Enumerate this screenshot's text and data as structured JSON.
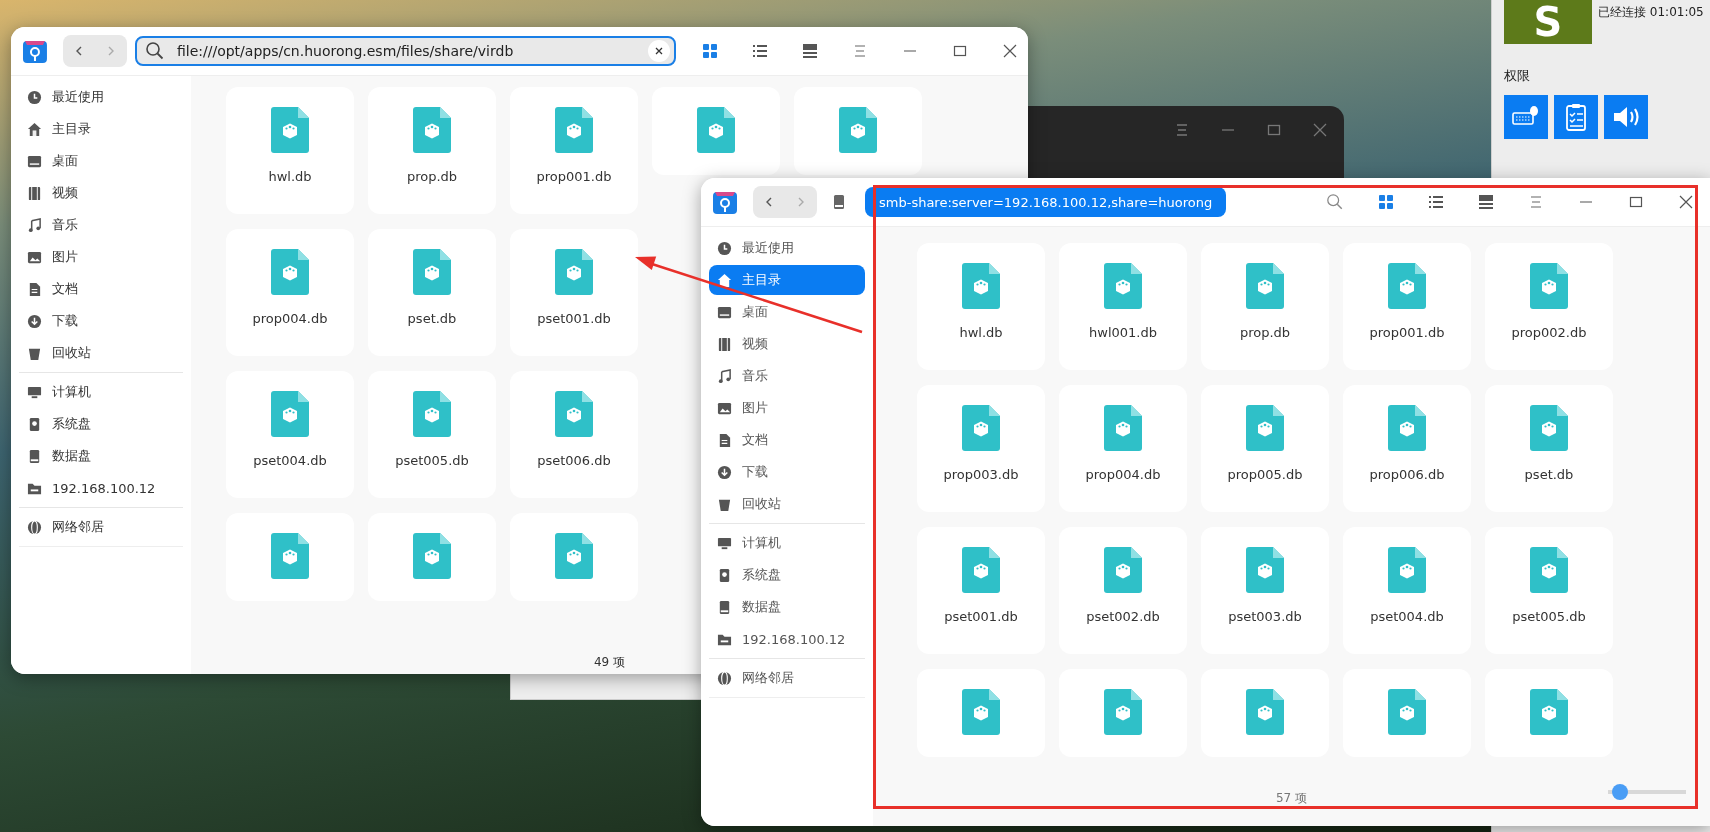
{
  "status_panel": {
    "avatar_letter": "S",
    "connection": "已经连接 01:01:05",
    "section_title": "权限"
  },
  "windows": [
    {
      "address": {
        "kind": "field",
        "value": "file:///opt/apps/cn.huorong.esm/files/share/virdb"
      },
      "views": [
        {
          "selected": true
        },
        {
          "selected": false
        },
        {
          "selected": false
        }
      ],
      "sidebar": [
        [
          {
            "label": "最近使用",
            "selected": false
          },
          {
            "label": "主目录",
            "selected": false
          },
          {
            "label": "桌面",
            "selected": false
          },
          {
            "label": "视频",
            "selected": false
          },
          {
            "label": "音乐",
            "selected": false
          },
          {
            "label": "图片",
            "selected": false
          },
          {
            "label": "文档",
            "selected": false
          },
          {
            "label": "下载",
            "selected": false
          },
          {
            "label": "回收站",
            "selected": false
          }
        ],
        [
          {
            "label": "计算机",
            "selected": false
          },
          {
            "label": "系统盘",
            "selected": false
          },
          {
            "label": "数据盘",
            "selected": false
          },
          {
            "label": "192.168.100.12",
            "selected": false
          }
        ],
        [
          {
            "label": "网络邻居",
            "selected": false
          }
        ]
      ],
      "rows": [
        [
          {
            "name": "hwl.db"
          },
          {
            "name": "prop.db"
          },
          {
            "name": "prop001.db"
          },
          {},
          {}
        ],
        [
          {
            "name": "prop004.db"
          },
          {
            "name": "pset.db"
          },
          {
            "name": "pset001.db"
          }
        ],
        [
          {
            "name": "pset004.db"
          },
          {
            "name": "pset005.db"
          },
          {
            "name": "pset006.db"
          }
        ],
        [
          {},
          {},
          {}
        ]
      ],
      "status": "49 项"
    },
    {
      "address": {
        "kind": "breadcrumb",
        "value": "smb-share:server=192.168.100.12,share=huorong"
      },
      "views": [
        {
          "selected": true
        },
        {
          "selected": false
        },
        {
          "selected": false
        }
      ],
      "sidebar": [
        [
          {
            "label": "最近使用",
            "selected": false
          },
          {
            "label": "主目录",
            "selected": true
          },
          {
            "label": "桌面",
            "selected": false
          },
          {
            "label": "视频",
            "selected": false
          },
          {
            "label": "音乐",
            "selected": false
          },
          {
            "label": "图片",
            "selected": false
          },
          {
            "label": "文档",
            "selected": false
          },
          {
            "label": "下载",
            "selected": false
          },
          {
            "label": "回收站",
            "selected": false
          }
        ],
        [
          {
            "label": "计算机",
            "selected": false
          },
          {
            "label": "系统盘",
            "selected": false
          },
          {
            "label": "数据盘",
            "selected": false
          },
          {
            "label": "192.168.100.12",
            "selected": false
          }
        ],
        [
          {
            "label": "网络邻居",
            "selected": false
          }
        ]
      ],
      "rows": [
        [
          {
            "name": "hwl.db"
          },
          {
            "name": "hwl001.db"
          },
          {
            "name": "prop.db"
          },
          {
            "name": "prop001.db"
          },
          {
            "name": "prop002.db"
          }
        ],
        [
          {
            "name": "prop003.db"
          },
          {
            "name": "prop004.db"
          },
          {
            "name": "prop005.db"
          },
          {
            "name": "prop006.db"
          },
          {
            "name": "pset.db"
          }
        ],
        [
          {
            "name": "pset001.db"
          },
          {
            "name": "pset002.db"
          },
          {
            "name": "pset003.db"
          },
          {
            "name": "pset004.db"
          },
          {
            "name": "pset005.db"
          }
        ],
        [
          {},
          {},
          {},
          {},
          {}
        ]
      ],
      "status": "57 项",
      "zoom_slider": {
        "level": 0.15
      }
    }
  ],
  "annotations": {
    "highlight_rectangle": true,
    "pointer_arrow": true
  }
}
